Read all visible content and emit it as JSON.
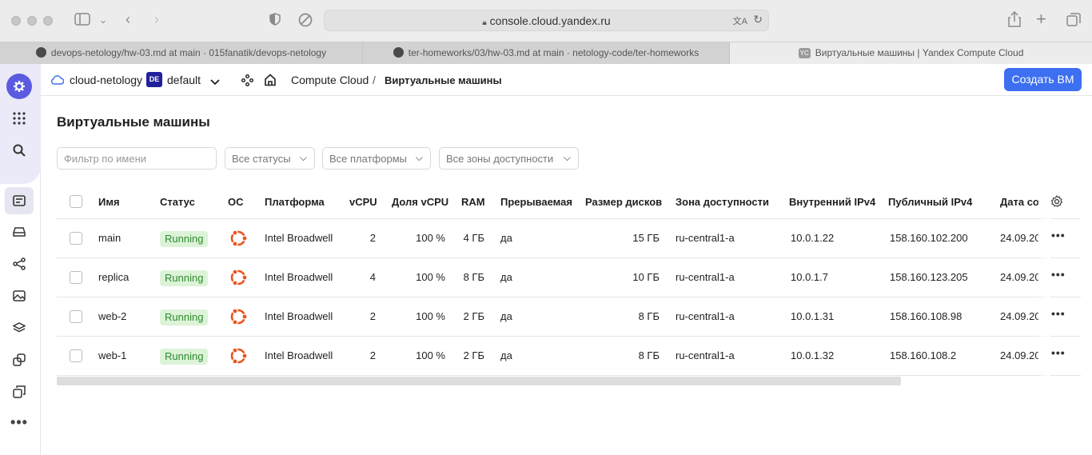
{
  "browser": {
    "url": "console.cloud.yandex.ru",
    "tabs": [
      {
        "label": "devops-netology/hw-03.md at main · 015fanatik/devops-netology"
      },
      {
        "label": "ter-homeworks/03/hw-03.md at main · netology-code/ter-homeworks"
      },
      {
        "label": "Виртуальные машины | Yandex Compute Cloud",
        "icon_text": "YC"
      }
    ]
  },
  "header": {
    "cloud": "cloud-netology",
    "folder_badge": "DE",
    "folder": "default",
    "service": "Compute Cloud",
    "separator": "/",
    "page": "Виртуальные машины",
    "create_button": "Создать ВМ"
  },
  "main": {
    "title": "Виртуальные машины",
    "filter_placeholder": "Фильтр по имени",
    "status_select": "Все статусы",
    "platform_select": "Все платформы",
    "zone_select": "Все зоны доступности"
  },
  "table": {
    "columns": [
      "Имя",
      "Статус",
      "ОС",
      "Платформа",
      "vCPU",
      "Доля vCPU",
      "RAM",
      "Прерываемая",
      "Размер дисков",
      "Зона доступности",
      "Внутренний IPv4",
      "Публичный IPv4",
      "Дата со"
    ],
    "rows": [
      {
        "name": "main",
        "status": "Running",
        "platform": "Intel Broadwell",
        "vcpu": "2",
        "share": "100 %",
        "ram": "4 ГБ",
        "preemptible": "да",
        "disk": "15 ГБ",
        "zone": "ru-central1-a",
        "internal_ip": "10.0.1.22",
        "public_ip": "158.160.102.200",
        "date": "24.09.20"
      },
      {
        "name": "replica",
        "status": "Running",
        "platform": "Intel Broadwell",
        "vcpu": "4",
        "share": "100 %",
        "ram": "8 ГБ",
        "preemptible": "да",
        "disk": "10 ГБ",
        "zone": "ru-central1-a",
        "internal_ip": "10.0.1.7",
        "public_ip": "158.160.123.205",
        "date": "24.09.20"
      },
      {
        "name": "web-2",
        "status": "Running",
        "platform": "Intel Broadwell",
        "vcpu": "2",
        "share": "100 %",
        "ram": "2 ГБ",
        "preemptible": "да",
        "disk": "8 ГБ",
        "zone": "ru-central1-a",
        "internal_ip": "10.0.1.31",
        "public_ip": "158.160.108.98",
        "date": "24.09.20"
      },
      {
        "name": "web-1",
        "status": "Running",
        "platform": "Intel Broadwell",
        "vcpu": "2",
        "share": "100 %",
        "ram": "2 ГБ",
        "preemptible": "да",
        "disk": "8 ГБ",
        "zone": "ru-central1-a",
        "internal_ip": "10.0.1.32",
        "public_ip": "158.160.108.2",
        "date": "24.09.20"
      }
    ]
  },
  "colors": {
    "accent": "#3d6ff1",
    "brand": "#5a5bdf",
    "running_bg": "#dcf3d8",
    "running_text": "#2e8b2e",
    "ubuntu": "#e95420"
  }
}
